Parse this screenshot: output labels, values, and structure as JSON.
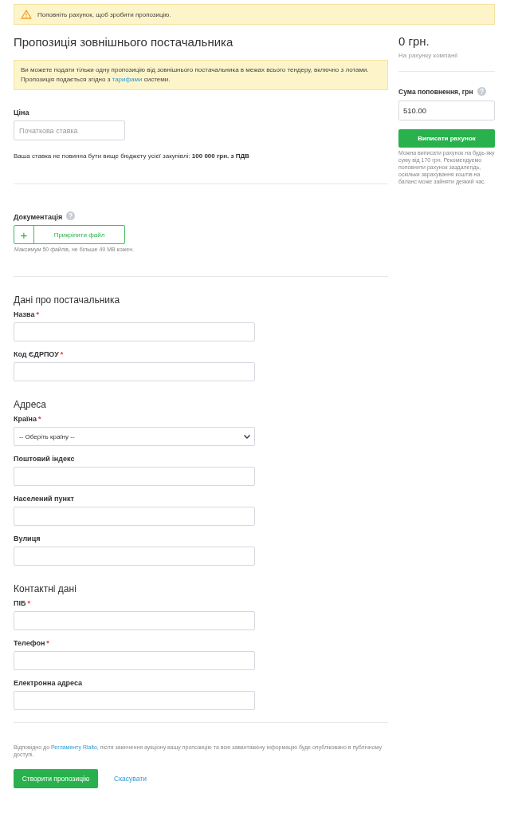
{
  "alert": {
    "text": "Поповніть рахунок, щоб зробити пропозицію."
  },
  "title": "Пропозиція зовнішнього постачальника",
  "notice": {
    "text": "Ви можете подати тільки одну пропозицію від зовнішнього постачальника в межах всього тендеру, включно з лотами. Пропозиція подається згідно з ",
    "link": "тарифами",
    "text_after": " системи."
  },
  "price": {
    "label": "Ціна",
    "placeholder": "Початкова ставка",
    "note": "Ваша ставка не повинна бути вище бюджету усієї закупівлі: **100 000 грн. з ПДВ**"
  },
  "documents": {
    "label": "Документація",
    "button_icon": "+",
    "button": "Прикріпити файл",
    "hint": "Максимум 50 файлів, не більше 49 MB кожен."
  },
  "sections": [
    {
      "title": "Дані про постачальника",
      "fields": [
        {
          "label": "Назва",
          "mark": "*",
          "kind": "text"
        },
        {
          "label": "Код ЄДРПОУ",
          "mark": "*",
          "kind": "text"
        }
      ]
    },
    {
      "title": "Адреса",
      "fields": [
        {
          "label": "Країна",
          "mark": "*",
          "kind": "select",
          "value": "-- Оберіть країну --"
        },
        {
          "label": "Поштовий індекс",
          "kind": "text"
        },
        {
          "label": "Населений пункт",
          "kind": "text"
        },
        {
          "label": "Вулиця",
          "kind": "text"
        }
      ]
    },
    {
      "title": "Контактні дані",
      "fields": [
        {
          "label": "ПІБ",
          "mark": "*",
          "kind": "text"
        },
        {
          "label": "Телефон",
          "mark": "*",
          "kind": "text"
        },
        {
          "label": "Електронна адреса",
          "kind": "text"
        }
      ]
    }
  ],
  "legal": {
    "text_before": "Відповідно до ",
    "link": "Регламенту Rialto",
    "text_after": ", після закінчення аукціону вашу пропозицію та всю завантажену інформацію буде опубліковано в публічному доступі."
  },
  "actions": {
    "submit": "Створити пропозицію",
    "cancel": "Скасувати"
  },
  "sidebar": {
    "balance": "0 грн.",
    "balance_caption": "На рахунку компанії",
    "topup_label": "Сума поповнення, грн",
    "topup_value": "510.00",
    "invoice_button": "Виписати рахунок",
    "note": "Можна виписати рахунок на будь-яку суму від 170 грн. Рекомендуємо поповнити рахунок заздалегідь, оскільки зарахування коштів на баланс може зайняти деякий час."
  }
}
